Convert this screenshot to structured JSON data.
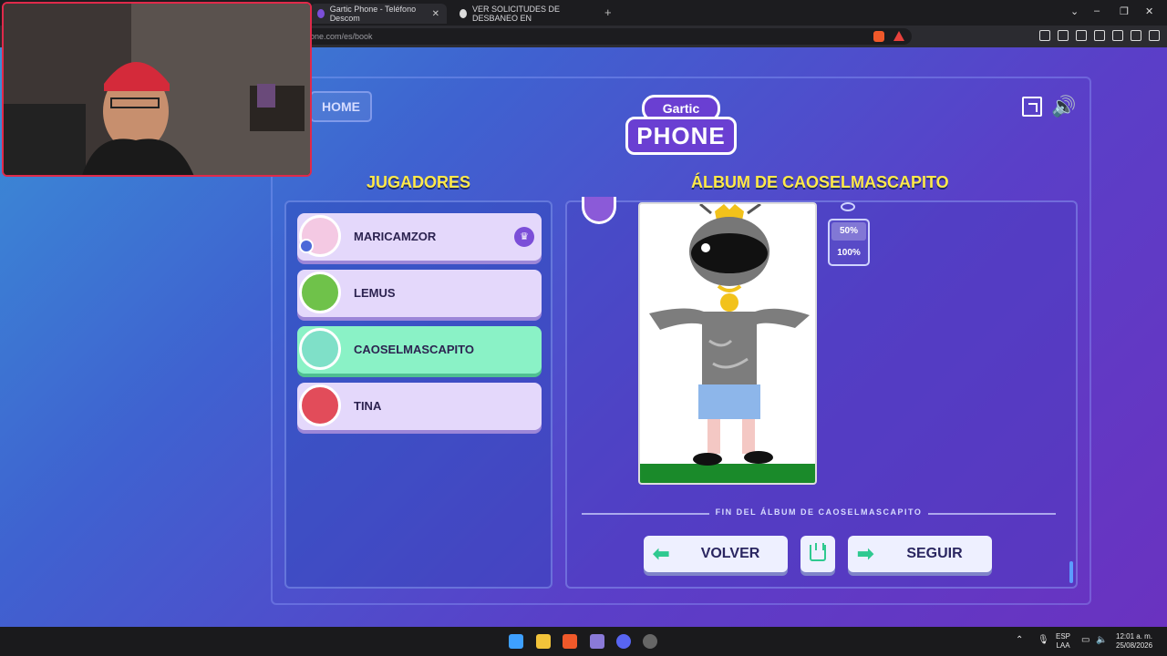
{
  "browser": {
    "tabs": [
      {
        "label": "Gartic Phone - Teléfono Descom",
        "active": true
      },
      {
        "label": "VER SOLICITUDES DE DESBANEO EN",
        "active": false
      }
    ],
    "url": "one.com/es/book"
  },
  "game": {
    "home_label": "HOME",
    "logo_top": "Gartic",
    "logo_bottom": "PHONE",
    "players_title": "JUGADORES",
    "album_title": "ÁLBUM DE CAOSELMASCAPITO",
    "players": [
      {
        "name": "MARICAMZOR",
        "host": true,
        "active": false,
        "avatar_color": "#f4c9e3"
      },
      {
        "name": "LEMUS",
        "host": false,
        "active": false,
        "avatar_color": "#6fc24a"
      },
      {
        "name": "CAOSELMASCAPITO",
        "host": false,
        "active": true,
        "avatar_color": "#7fe0c8"
      },
      {
        "name": "TINA",
        "host": false,
        "active": false,
        "avatar_color": "#e24c5a"
      }
    ],
    "zoom": {
      "options": [
        "50%",
        "100%"
      ],
      "selected": "50%"
    },
    "end_text": "FIN DEL ÁLBUM DE CAOSELMASCAPITO",
    "back_label": "VOLVER",
    "next_label": "SEGUIR"
  },
  "taskbar": {
    "lang_top": "ESP",
    "lang_bottom": "LAA",
    "time": "12:01 a. m.",
    "date": "25/08/2026"
  },
  "colors": {
    "title_yellow": "#ffe94a",
    "active_player": "#8af2c6",
    "accent_green": "#2fc990"
  }
}
